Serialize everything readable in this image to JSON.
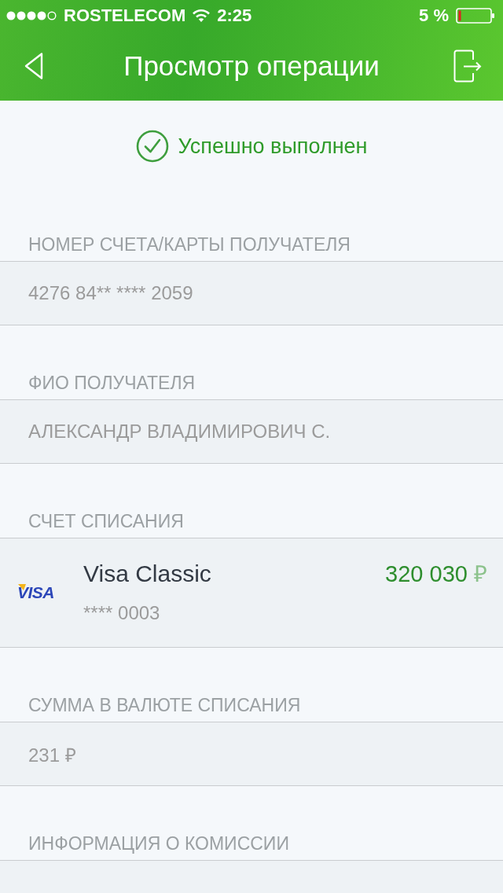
{
  "status_bar": {
    "carrier": "ROSTELECOM",
    "time": "2:25",
    "battery": "5 %"
  },
  "nav_bar": {
    "title": "Просмотр операции"
  },
  "status": {
    "text": "Успешно выполнен"
  },
  "fields": [
    {
      "kind": "text",
      "label": "НОМЕР СЧЕТА/КАРТЫ ПОЛУЧАТЕЛЯ",
      "value": "4276 84** **** 2059"
    },
    {
      "kind": "text",
      "label": "ФИО ПОЛУЧАТЕЛЯ",
      "value": "АЛЕКСАНДР ВЛАДИМИРОВИЧ С."
    },
    {
      "kind": "card",
      "label": "СЧЕТ СПИСАНИЯ",
      "card": {
        "brand": "VISA",
        "name": "Visa Classic",
        "number": "**** 0003",
        "amount": "320 030",
        "currency": "₽"
      }
    },
    {
      "kind": "text",
      "label": "СУММА В ВАЛЮТЕ СПИСАНИЯ",
      "value": "231 ₽"
    },
    {
      "kind": "text",
      "label": "ИНФОРМАЦИЯ О КОМИССИИ"
    }
  ]
}
